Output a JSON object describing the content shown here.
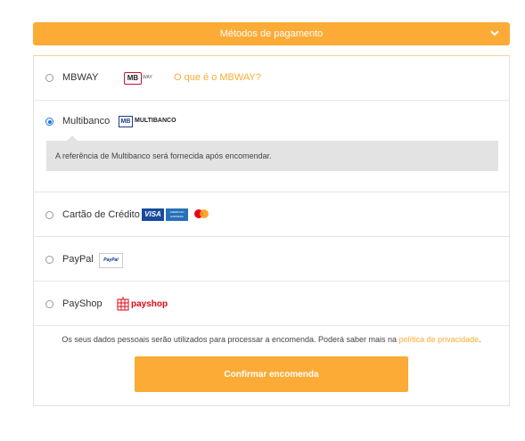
{
  "header": {
    "title": "Métodos de pagamento",
    "chevron_icon": "chevron-down-icon"
  },
  "methods": [
    {
      "label": "MBWAY",
      "selected": false,
      "logo": "mbway-logo",
      "link": "O que é o MBWAY?"
    },
    {
      "label": "Multibanco",
      "selected": true,
      "logo": "multibanco-logo",
      "info": "A referência de Multibanco será fornecida após encomendar."
    },
    {
      "label": "Cartão de Crédito",
      "selected": false,
      "logo": "credit-cards-logo"
    },
    {
      "label": "PayPal",
      "selected": false,
      "logo": "paypal-logo"
    },
    {
      "label": "PayShop",
      "selected": false,
      "logo": "payshop-logo"
    }
  ],
  "legal": {
    "text": "Os seus dados pessoais serão utilizados para processar a encomenda. Poderá saber mais na ",
    "link": "política de privacidade",
    "end": "."
  },
  "confirm_button": "Confirmar encomenda",
  "logos": {
    "mb": "MB",
    "way": "WAY",
    "multibanco": "MULTIBANCO",
    "visa": "VISA",
    "amex": "AMERICAN EXPRESS",
    "paypal": "PayPal",
    "payshop": "payshop"
  },
  "colors": {
    "accent": "#fbab36",
    "radio_selected": "#1a73e8"
  }
}
